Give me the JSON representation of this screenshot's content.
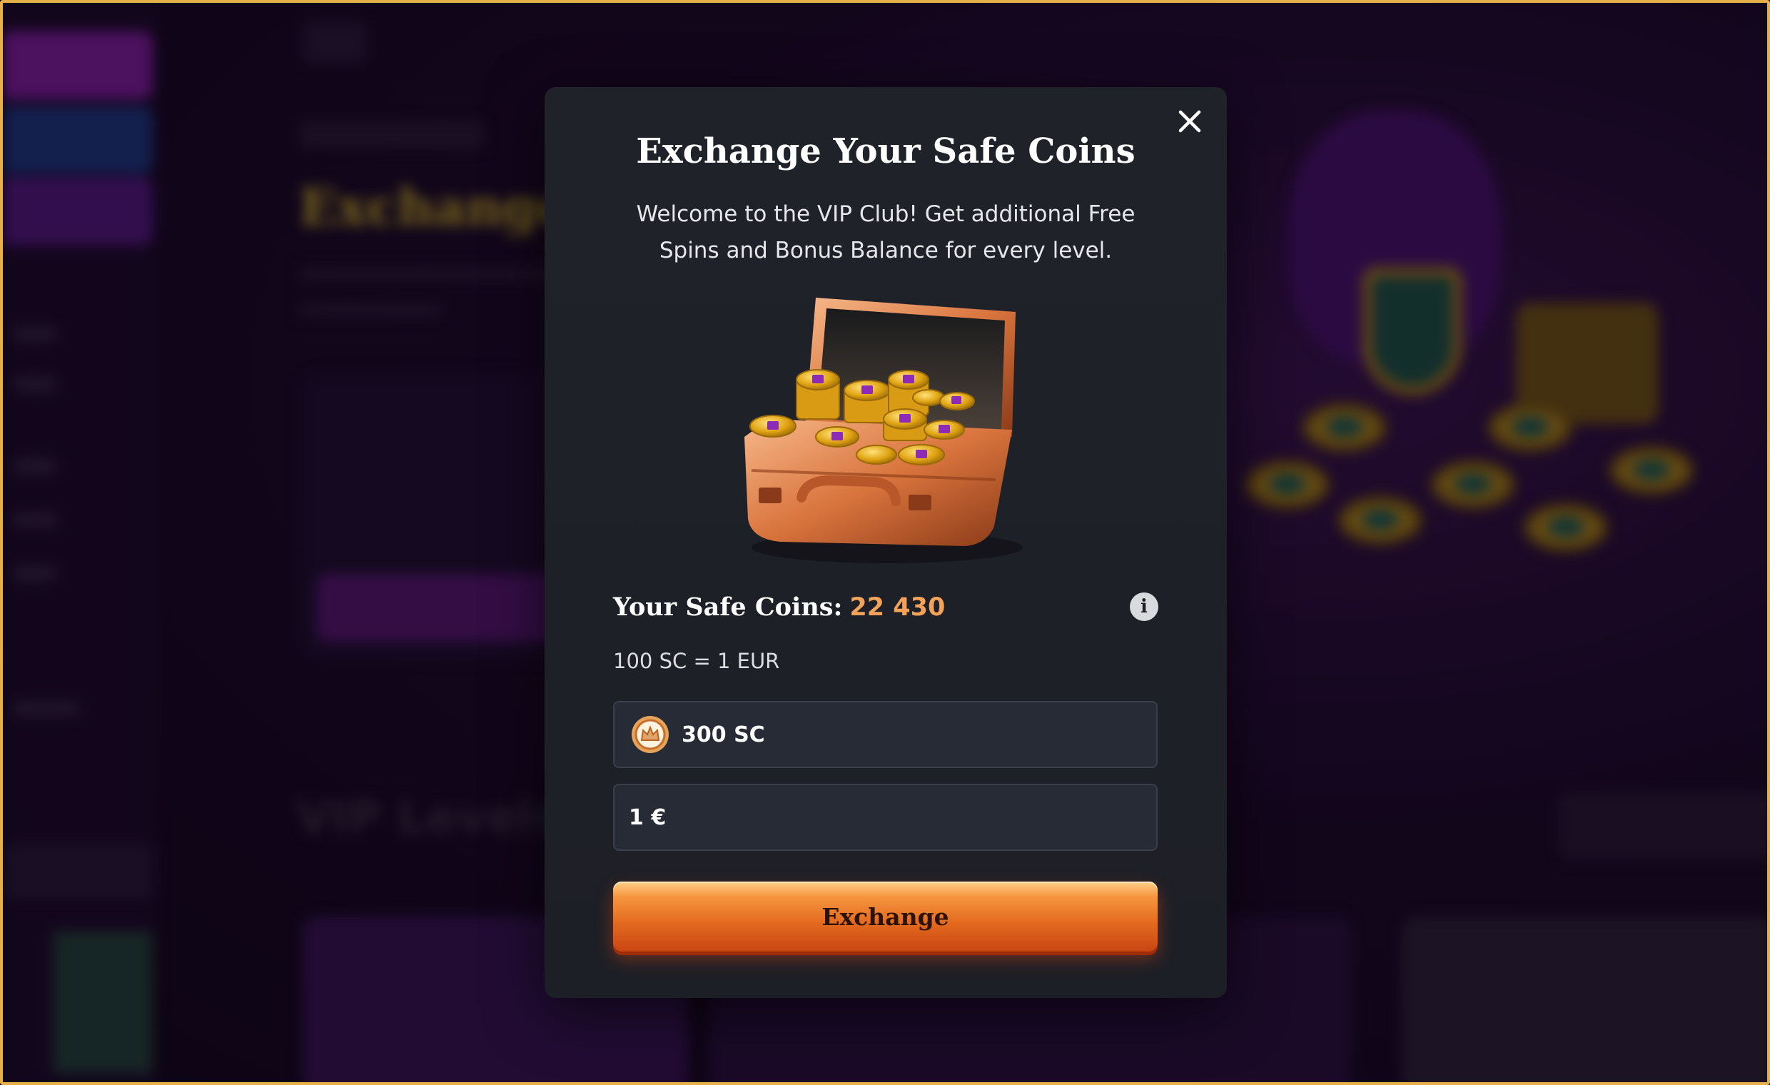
{
  "modal": {
    "title": "Exchange Your Safe Coins",
    "description": "Welcome to the VIP Club! Get additional Free Spins and Bonus Balance for every level.",
    "balance_label": "Your Safe Coins:",
    "balance_value": "22 430",
    "rate_text": "100 SC = 1 EUR",
    "sc_input_value": "300 SC",
    "eur_input_value": "1 €",
    "exchange_label": "Exchange",
    "icons": {
      "close": "close-icon",
      "info": "info-icon",
      "coin": "safe-coin-icon",
      "hero": "coin-briefcase-illustration"
    }
  },
  "colors": {
    "accent_orange": "#f3a25a",
    "button_gradient_top": "#f6953e",
    "button_gradient_bottom": "#c94612",
    "modal_bg": "#1d1f26",
    "field_bg": "#272b36",
    "frame_gold": "#e5b04a"
  }
}
